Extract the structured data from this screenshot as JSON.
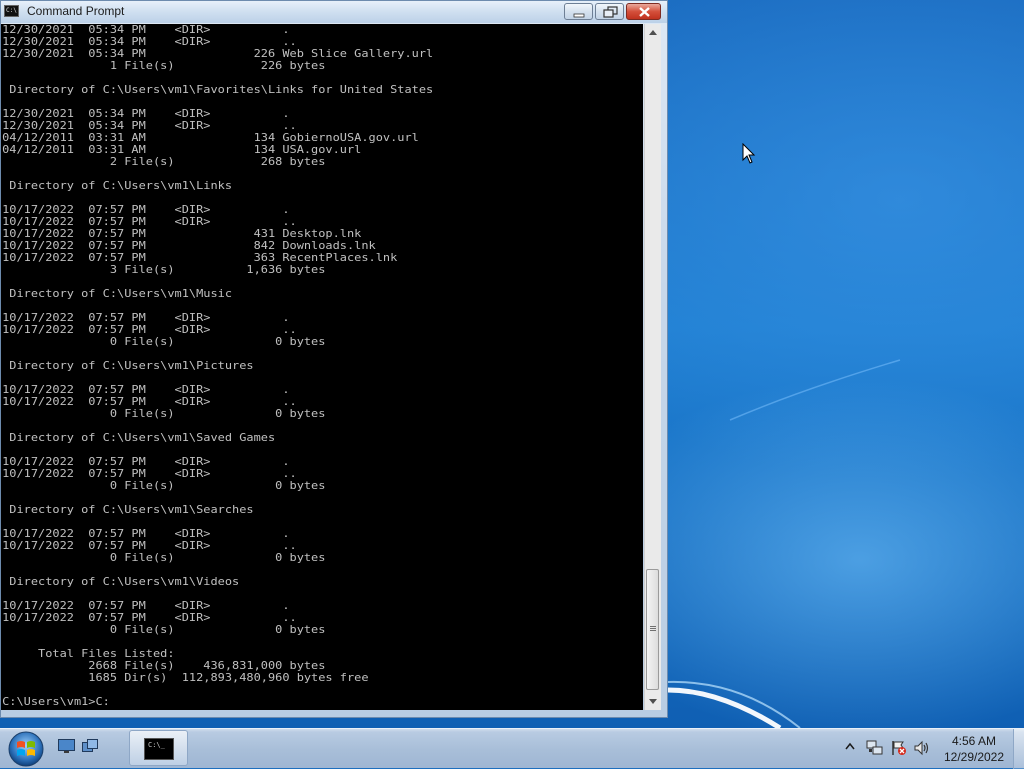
{
  "window": {
    "title": "Command Prompt",
    "icon": "cmd-icon",
    "buttons": [
      "minimize-icon",
      "maximize-icon",
      "close-icon"
    ]
  },
  "console": {
    "lines": [
      "12/30/2021  05:34 PM    <DIR>          .",
      "12/30/2021  05:34 PM    <DIR>          ..",
      "12/30/2021  05:34 PM               226 Web Slice Gallery.url",
      "               1 File(s)            226 bytes",
      "",
      " Directory of C:\\Users\\vm1\\Favorites\\Links for United States",
      "",
      "12/30/2021  05:34 PM    <DIR>          .",
      "12/30/2021  05:34 PM    <DIR>          ..",
      "04/12/2011  03:31 AM               134 GobiernoUSA.gov.url",
      "04/12/2011  03:31 AM               134 USA.gov.url",
      "               2 File(s)            268 bytes",
      "",
      " Directory of C:\\Users\\vm1\\Links",
      "",
      "10/17/2022  07:57 PM    <DIR>          .",
      "10/17/2022  07:57 PM    <DIR>          ..",
      "10/17/2022  07:57 PM               431 Desktop.lnk",
      "10/17/2022  07:57 PM               842 Downloads.lnk",
      "10/17/2022  07:57 PM               363 RecentPlaces.lnk",
      "               3 File(s)          1,636 bytes",
      "",
      " Directory of C:\\Users\\vm1\\Music",
      "",
      "10/17/2022  07:57 PM    <DIR>          .",
      "10/17/2022  07:57 PM    <DIR>          ..",
      "               0 File(s)              0 bytes",
      "",
      " Directory of C:\\Users\\vm1\\Pictures",
      "",
      "10/17/2022  07:57 PM    <DIR>          .",
      "10/17/2022  07:57 PM    <DIR>          ..",
      "               0 File(s)              0 bytes",
      "",
      " Directory of C:\\Users\\vm1\\Saved Games",
      "",
      "10/17/2022  07:57 PM    <DIR>          .",
      "10/17/2022  07:57 PM    <DIR>          ..",
      "               0 File(s)              0 bytes",
      "",
      " Directory of C:\\Users\\vm1\\Searches",
      "",
      "10/17/2022  07:57 PM    <DIR>          .",
      "10/17/2022  07:57 PM    <DIR>          ..",
      "               0 File(s)              0 bytes",
      "",
      " Directory of C:\\Users\\vm1\\Videos",
      "",
      "10/17/2022  07:57 PM    <DIR>          .",
      "10/17/2022  07:57 PM    <DIR>          ..",
      "               0 File(s)              0 bytes",
      "",
      "     Total Files Listed:",
      "            2668 File(s)    436,831,000 bytes",
      "            1685 Dir(s)  112,893,480,960 bytes free",
      "",
      "C:\\Users\\vm1>C:"
    ],
    "foreground_color": "#c0c0c0",
    "background_color": "#000000"
  },
  "taskbar": {
    "start_icon": "windows-logo-icon",
    "quick_launch": [
      "show-desktop-icon",
      "switch-windows-icon"
    ],
    "active_task_icon": "cmd-icon",
    "active_task_icon_text": "C:\\_",
    "tray_icons": [
      "show-hidden-icons-chevron",
      "network-icon",
      "action-center-flag-icon",
      "volume-icon"
    ],
    "clock": {
      "time": "4:56 AM",
      "date": "12/29/2022"
    }
  }
}
